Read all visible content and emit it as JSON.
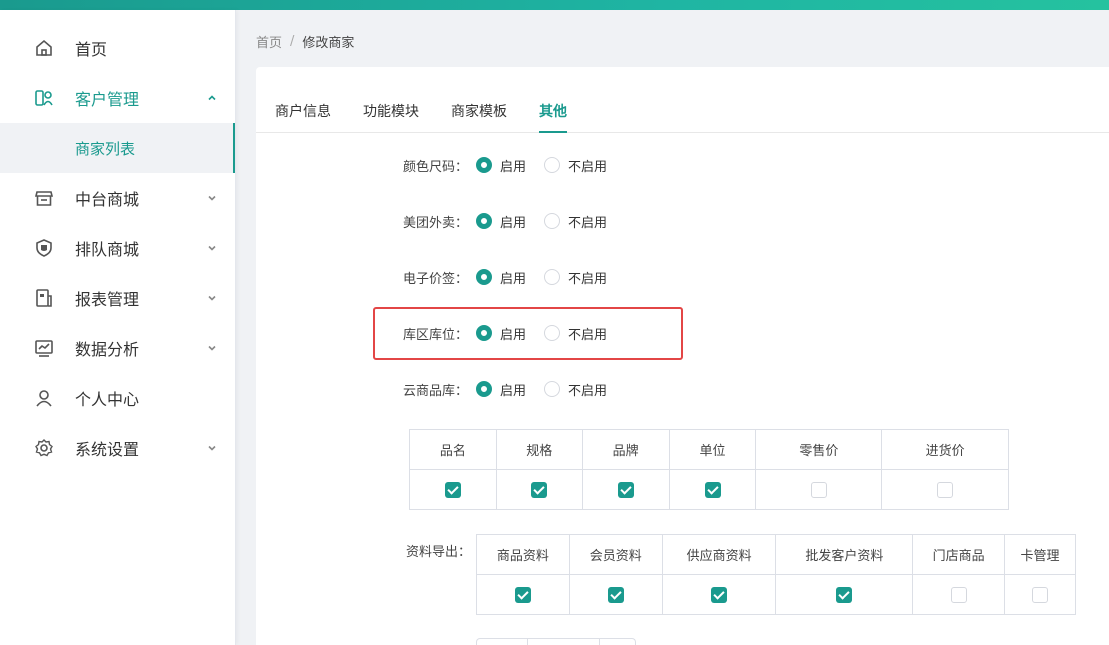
{
  "colors": {
    "accent": "#1a9a8e",
    "highlight": "#e34646"
  },
  "sidebar": {
    "items": [
      {
        "label": "首页",
        "icon": "home-icon"
      },
      {
        "label": "客户管理",
        "icon": "customer-icon",
        "expanded": true
      },
      {
        "label": "中台商城",
        "icon": "store-icon"
      },
      {
        "label": "排队商城",
        "icon": "shield-icon"
      },
      {
        "label": "报表管理",
        "icon": "report-icon"
      },
      {
        "label": "数据分析",
        "icon": "chart-icon"
      },
      {
        "label": "个人中心",
        "icon": "user-icon"
      },
      {
        "label": "系统设置",
        "icon": "gear-icon"
      }
    ],
    "submenu": {
      "label": "商家列表",
      "active": true
    }
  },
  "breadcrumb": {
    "home": "首页",
    "separator": "/",
    "current": "修改商家"
  },
  "tabs": [
    {
      "label": "商户信息"
    },
    {
      "label": "功能模块"
    },
    {
      "label": "商家模板"
    },
    {
      "label": "其他",
      "active": true
    }
  ],
  "options": [
    {
      "label": "颜色尺码：",
      "enabled": true
    },
    {
      "label": "美团外卖：",
      "enabled": true
    },
    {
      "label": "电子价签：",
      "enabled": true
    },
    {
      "label": "库区库位：",
      "enabled": true
    },
    {
      "label": "云商品库：",
      "enabled": true
    }
  ],
  "radio_labels": {
    "on": "启用",
    "off": "不启用"
  },
  "cloud_fields": {
    "headers": [
      "品名",
      "规格",
      "品牌",
      "单位",
      "零售价",
      "进货价"
    ],
    "checked": [
      true,
      true,
      true,
      true,
      false,
      false
    ]
  },
  "export": {
    "label": "资料导出：",
    "headers": [
      "商品资料",
      "会员资料",
      "供应商资料",
      "批发客户资料",
      "门店商品",
      "卡管理"
    ],
    "checked": [
      true,
      true,
      true,
      true,
      false,
      false
    ]
  }
}
